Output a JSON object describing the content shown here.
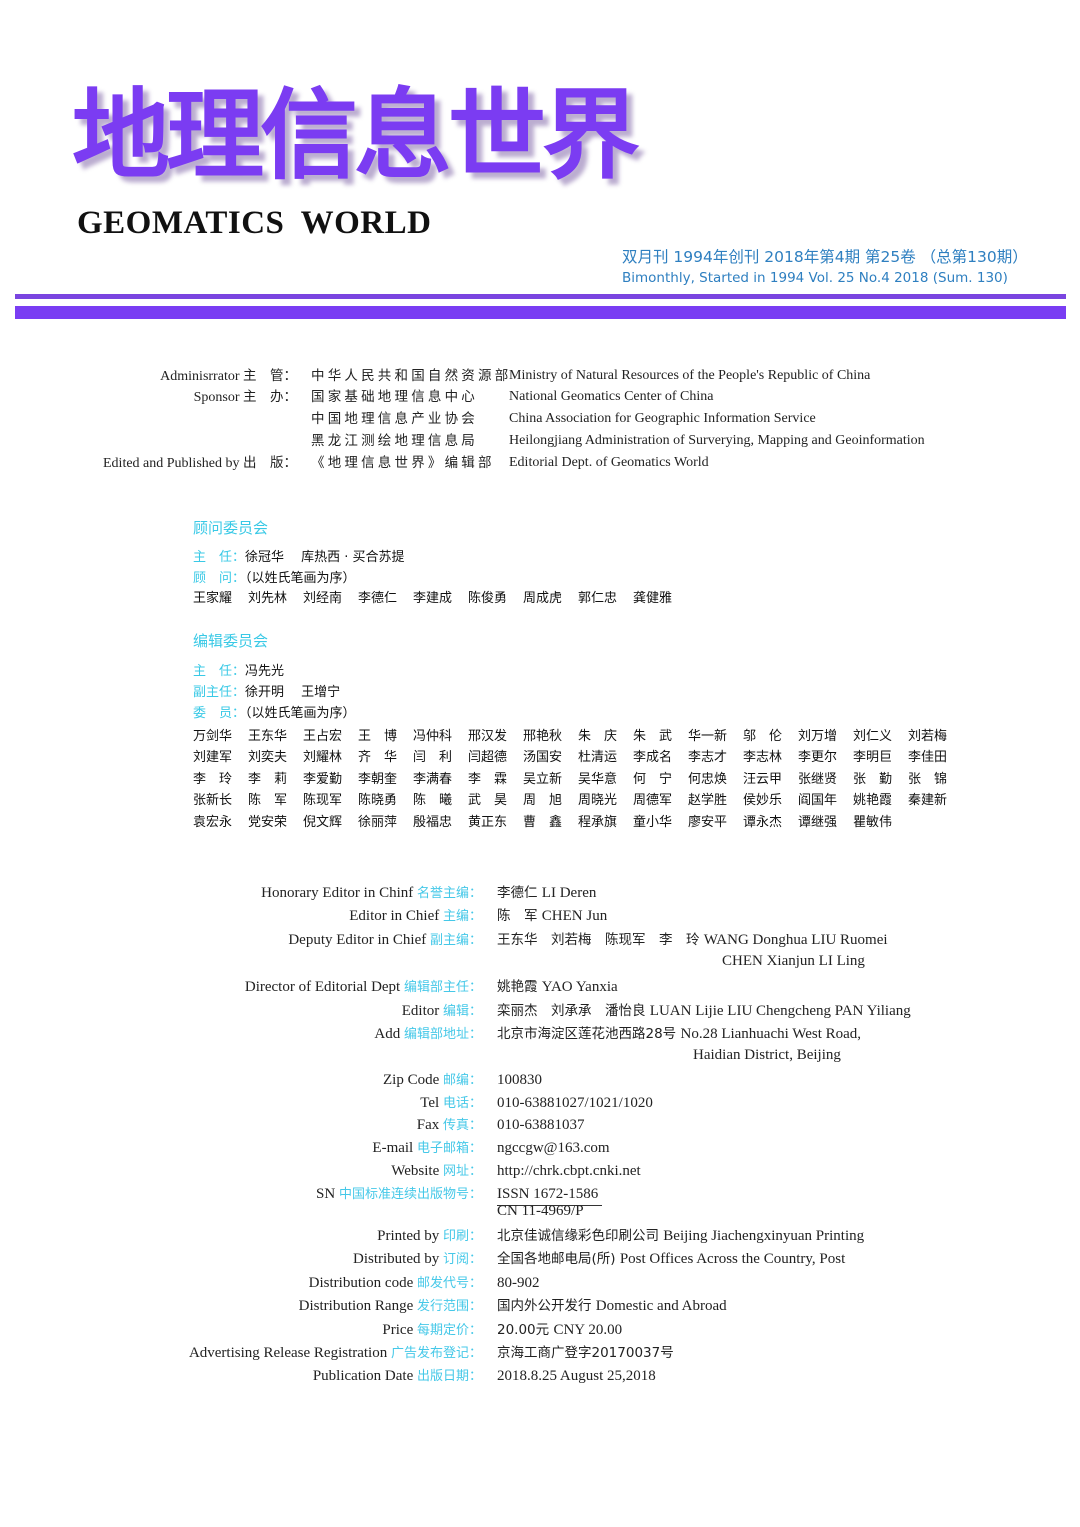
{
  "masthead": {
    "title_cn": "地理信息世界",
    "title_en": "GEOMATICS  WORLD",
    "issue_cn": "双月刊  1994年创刊  2018年第4期  第25卷  （总第130期）",
    "issue_en": "Bimonthly, Started in 1994 Vol. 25 No.4 2018 (Sum. 130)",
    "colors": {
      "title": "#7b3cf2",
      "issue_text": "#2e7fc0",
      "rule": "#7a3df3",
      "label_accent": "#39c9e6"
    }
  },
  "sponsors": [
    {
      "key_en": "Adminisrrator",
      "key_cn": "主　管：",
      "cn": "中华人民共和国自然资源部",
      "en": "Ministry of Natural Resources of the People's Republic of China"
    },
    {
      "key_en": "Sponsor",
      "key_cn": "主　办：",
      "cn": "国家基础地理信息中心",
      "en": "National Geomatics Center of China"
    },
    {
      "key_en": "",
      "key_cn": "",
      "cn": "中国地理信息产业协会",
      "en": "China Association for Geographic Information Service"
    },
    {
      "key_en": "",
      "key_cn": "",
      "cn": "黑龙江测绘地理信息局",
      "en": "Heilongjiang Administration of Surverying, Mapping and Geoinformation"
    },
    {
      "key_en": "Edited and Published by",
      "key_cn": "出　版：",
      "cn": "《地理信息世界》编辑部",
      "en": "Editorial Dept. of Geomatics World"
    }
  ],
  "advisory_committee": {
    "heading": "顾问委员会",
    "director_label": "主　任：",
    "director_value": "徐冠华　 库热西 · 买合苏提",
    "advisors_label": "顾　问：",
    "advisors_note": "（以姓氏笔画为序）",
    "members": [
      "王家耀",
      "刘先林",
      "刘经南",
      "李德仁",
      "李建成",
      "陈俊勇",
      "周成虎",
      "郭仁忠",
      "龚健雅"
    ]
  },
  "editorial_committee": {
    "heading": "编辑委员会",
    "director_label": "主　任：",
    "director_value": "冯先光",
    "deputy_label": "副主任：",
    "deputy_value": "徐开明　 王增宁",
    "members_label": "委　员：",
    "members_note": "（以姓氏笔画为序）",
    "members": [
      "万剑华",
      "王东华",
      "王占宏",
      "王　博",
      "冯仲科",
      "邢汉发",
      "邢艳秋",
      "朱　庆",
      "朱　武",
      "华一新",
      "邬　伦",
      "刘万增",
      "刘仁义",
      "刘若梅",
      "刘建军",
      "刘奕夫",
      "刘耀林",
      "齐　华",
      "闫　利",
      "闫超德",
      "汤国安",
      "杜清运",
      "李成名",
      "李志才",
      "李志林",
      "李更尔",
      "李明巨",
      "李佳田",
      "李　玲",
      "李　莉",
      "李爱勤",
      "李朝奎",
      "李满春",
      "李　霖",
      "吴立新",
      "吴华意",
      "何　宁",
      "何忠焕",
      "汪云甲",
      "张继贤",
      "张　勤",
      "张　锦",
      "张新长",
      "陈　军",
      "陈现军",
      "陈晓勇",
      "陈　曦",
      "武　昊",
      "周　旭",
      "周晓光",
      "周德军",
      "赵学胜",
      "侯妙乐",
      "阎国年",
      "姚艳霞",
      "秦建新",
      "袁宏永",
      "党安荣",
      "倪文辉",
      "徐丽萍",
      "殷福忠",
      "黄正东",
      "曹　鑫",
      "程承旗",
      "童小华",
      "廖安平",
      "谭永杰",
      "谭继强",
      "瞿敏伟"
    ]
  },
  "info": [
    {
      "en": "Honorary Editor in Chinf",
      "cn": "名誉主编：",
      "value_cn": "李德仁",
      "value_en": "LI Deren"
    },
    {
      "en": "Editor in Chief",
      "cn": "主编：",
      "value_cn": "陈　军",
      "value_en": "CHEN Jun"
    },
    {
      "en": "Deputy Editor in Chief",
      "cn": "副主编：",
      "value_cn": "王东华　刘若梅　陈现军　李　玲",
      "value_en": "WANG Donghua  LIU Ruomei",
      "value_en_2": "CHEN Xianjun  LI Ling"
    },
    {
      "en": "Director of Editorial Dept",
      "cn": "编辑部主任：",
      "value_cn": "姚艳霞",
      "value_en": "YAO Yanxia"
    },
    {
      "en": "Editor",
      "cn": "编辑：",
      "value_cn": "栾丽杰　刘承承　潘怡良",
      "value_en": "LUAN Lijie  LIU Chengcheng  PAN Yiliang"
    },
    {
      "en": "Add",
      "cn": "编辑部地址：",
      "value_cn": "北京市海淀区莲花池西路28号",
      "value_en": "No.28 Lianhuachi West Road,",
      "value_en_2": "Haidian District, Beijing"
    },
    {
      "en": "Zip Code",
      "cn": "邮编：",
      "value_cn": "",
      "value_en": "100830"
    },
    {
      "en": "Tel",
      "cn": "电话：",
      "value_cn": "",
      "value_en": "010-63881027/1021/1020"
    },
    {
      "en": "Fax",
      "cn": "传真：",
      "value_cn": "",
      "value_en": "010-63881037"
    },
    {
      "en": "E-mail",
      "cn": "电子邮箱：",
      "value_cn": "",
      "value_en": "ngccgw@163.com"
    },
    {
      "en": "Website",
      "cn": "网址：",
      "value_cn": "",
      "value_en": "http://chrk.cbpt.cnki.net"
    },
    {
      "en": "SN",
      "cn": "中国标准连续出版物号：",
      "value_cn": "",
      "value_en": "ISSN 1672-1586",
      "value_en_2": "CN 11-4969/P"
    },
    {
      "en": "Printed by",
      "cn": "印刷：",
      "value_cn": "北京佳诚信缘彩色印刷公司",
      "value_en": "Beijing Jiachengxinyuan Printing"
    },
    {
      "en": "Distributed by",
      "cn": "订阅：",
      "value_cn": "全国各地邮电局(所)",
      "value_en": "Post Offices Across the Country, Post"
    },
    {
      "en": "Distribution code",
      "cn": "邮发代号：",
      "value_cn": "",
      "value_en": "80-902"
    },
    {
      "en": "Distribution Range",
      "cn": "发行范围：",
      "value_cn": "国内外公开发行",
      "value_en": "Domestic and Abroad"
    },
    {
      "en": "Price",
      "cn": "每期定价：",
      "value_cn": "20.00元",
      "value_en": "CNY 20.00"
    },
    {
      "en": "Advertising Release Registration",
      "cn": "广告发布登记：",
      "value_cn": "京海工商广登字20170037号",
      "value_en": ""
    },
    {
      "en": "Publication Date",
      "cn": "出版日期：",
      "value_cn": "",
      "value_en": "2018.8.25  August 25,2018"
    }
  ]
}
